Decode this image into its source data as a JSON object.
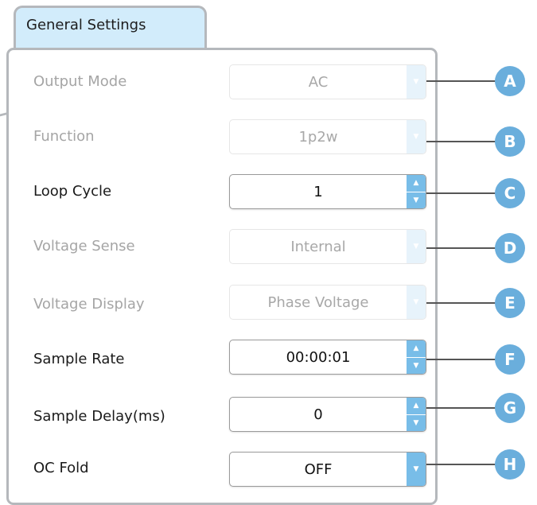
{
  "tab": {
    "label": "General Settings"
  },
  "rows": [
    {
      "label": "Output Mode",
      "value": "AC",
      "control": "dropdown",
      "enabled": false,
      "badge": "A"
    },
    {
      "label": "Function",
      "value": "1p2w",
      "control": "dropdown",
      "enabled": false,
      "badge": "B"
    },
    {
      "label": "Loop Cycle",
      "value": "1",
      "control": "spinner",
      "enabled": true,
      "badge": "C"
    },
    {
      "label": "Voltage Sense",
      "value": "Internal",
      "control": "dropdown",
      "enabled": false,
      "badge": "D"
    },
    {
      "label": "Voltage Display",
      "value": "Phase Voltage",
      "control": "dropdown",
      "enabled": false,
      "badge": "E"
    },
    {
      "label": "Sample Rate",
      "value": "00:00:01",
      "control": "spinner",
      "enabled": true,
      "badge": "F"
    },
    {
      "label": "Sample Delay(ms)",
      "value": "0",
      "control": "spinner",
      "enabled": true,
      "badge": "G"
    },
    {
      "label": "OC Fold",
      "value": "OFF",
      "control": "dropdown",
      "enabled": true,
      "badge": "H"
    }
  ],
  "colors": {
    "tab_fill": "#d2ecfb",
    "border": "#b5b8bc",
    "accent": "#78bde8",
    "badge": "#6aaedc",
    "disabled_text": "#a5a5a5"
  }
}
